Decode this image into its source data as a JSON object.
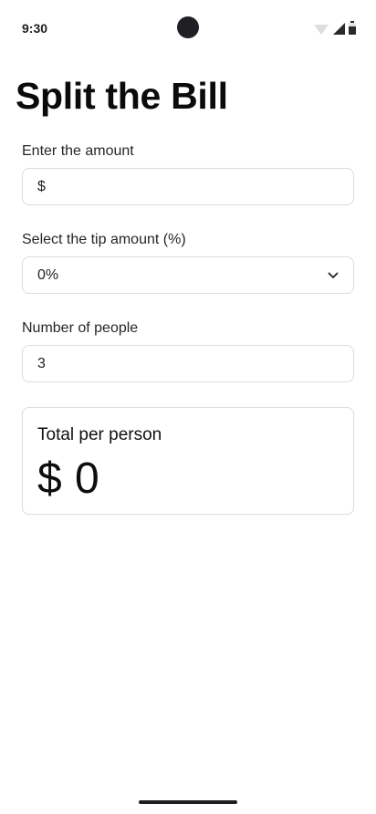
{
  "status_bar": {
    "time": "9:30",
    "icons": [
      "wifi-icon",
      "cell-signal-icon",
      "battery-icon"
    ]
  },
  "app": {
    "title": "Split the Bill"
  },
  "amount_field": {
    "label": "Enter the amount",
    "prefix": "$",
    "value": ""
  },
  "tip_field": {
    "label": "Select the tip amount (%)",
    "selected": "0%"
  },
  "people_field": {
    "label": "Number of people",
    "value": "3"
  },
  "result": {
    "title": "Total per person",
    "currency": "$",
    "amount": "0"
  },
  "colors": {
    "background": "#ffffff",
    "border": "#dcdcdc",
    "text": "#111111"
  }
}
